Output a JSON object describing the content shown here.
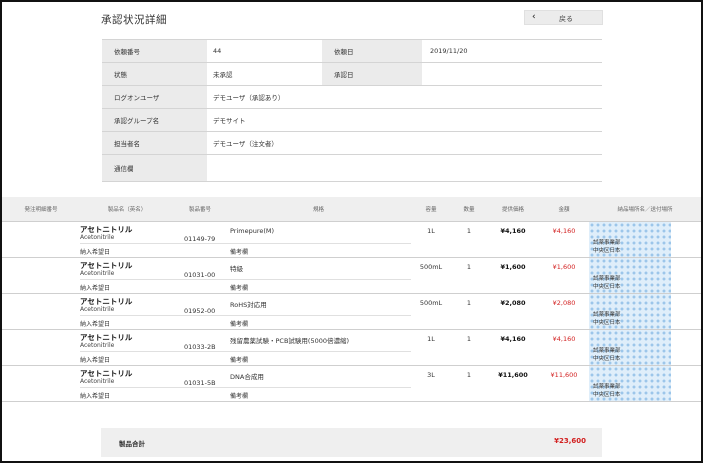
{
  "page": {
    "title": "承認状況詳細",
    "back_label": "戻る"
  },
  "info": {
    "request_no_label": "依頼番号",
    "request_no": "44",
    "request_date_label": "依頼日",
    "request_date": "2019/11/20",
    "status_label": "状態",
    "status": "未承認",
    "approval_date_label": "承認日",
    "approval_date": "",
    "login_user_label": "ログオンユーザ",
    "login_user": "デモユーザ（承認あり）",
    "approval_group_label": "承認グループ名",
    "approval_group": "デモサイト",
    "person_label": "担当者名",
    "person": "デモユーザ（注文者）",
    "comment_label": "通信欄",
    "comment": ""
  },
  "table": {
    "headers": [
      "発注明細番号",
      "製品名（英名）",
      "製品番号",
      "規格",
      "容量",
      "数量",
      "提供価格",
      "金額",
      "納品場所名／送付場所"
    ],
    "sub_labels": {
      "desired_delivery": "納入希望日",
      "memo": "備考欄"
    },
    "rows": [
      {
        "name": "アセトニトリル",
        "name_en": "Acetonitrile",
        "code": "01149-79",
        "spec": "Primepure(M)",
        "capacity": "1L",
        "qty": "1",
        "price": "¥4,160",
        "amount": "¥4,160",
        "dest1": "試薬事業部",
        "dest2": "中央区日本"
      },
      {
        "name": "アセトニトリル",
        "name_en": "Acetonitrile",
        "code": "01031-00",
        "spec": "特級",
        "capacity": "500mL",
        "qty": "1",
        "price": "¥1,600",
        "amount": "¥1,600",
        "dest1": "試薬事業部",
        "dest2": "中央区日本"
      },
      {
        "name": "アセトニトリル",
        "name_en": "Acetonitrile",
        "code": "01952-00",
        "spec": "RoHS対応用",
        "capacity": "500mL",
        "qty": "1",
        "price": "¥2,080",
        "amount": "¥2,080",
        "dest1": "試薬事業部",
        "dest2": "中央区日本"
      },
      {
        "name": "アセトニトリル",
        "name_en": "Acetonitrile",
        "code": "01033-2B",
        "spec": "残留農薬試験・PCB試験用(5000倍濃縮)",
        "capacity": "1L",
        "qty": "1",
        "price": "¥4,160",
        "amount": "¥4,160",
        "dest1": "試薬事業部",
        "dest2": "中央区日本"
      },
      {
        "name": "アセトニトリル",
        "name_en": "Acetonitrile",
        "code": "01031-5B",
        "spec": "DNA合成用",
        "capacity": "3L",
        "qty": "1",
        "price": "¥11,600",
        "amount": "¥11,600",
        "dest1": "試薬事業部",
        "dest2": "中央区日本"
      }
    ]
  },
  "total": {
    "label": "製品合計",
    "value": "¥23,600"
  },
  "colors": {
    "amount_red": "#d21f1f",
    "label_bg": "#ebebeb"
  }
}
